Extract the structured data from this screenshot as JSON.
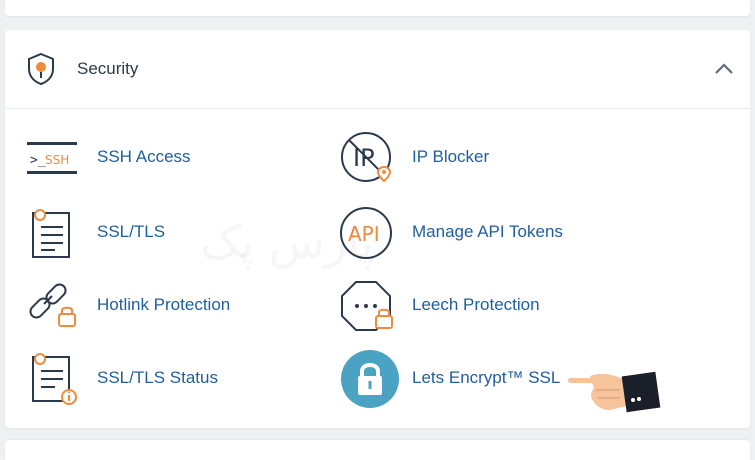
{
  "section": {
    "title": "Security",
    "icon": "security-shield-icon",
    "collapse_icon": "chevron-up-icon"
  },
  "items": [
    {
      "label": "SSH Access",
      "icon": "ssh-terminal-icon"
    },
    {
      "label": "IP Blocker",
      "icon": "ip-blocker-icon"
    },
    {
      "label": "SSL/TLS",
      "icon": "certificate-icon"
    },
    {
      "label": "Manage API Tokens",
      "icon": "api-icon"
    },
    {
      "label": "Hotlink Protection",
      "icon": "hotlink-chain-lock-icon"
    },
    {
      "label": "Leech Protection",
      "icon": "leech-protection-icon"
    },
    {
      "label": "SSL/TLS Status",
      "icon": "certificate-status-icon"
    },
    {
      "label": "Lets Encrypt™ SSL",
      "icon": "padlock-icon"
    }
  ],
  "watermark_text": "پارس پک",
  "colors": {
    "accent": "#f08a3c",
    "link": "#1f5e9e",
    "lets_encrypt_bg": "#4ba3c3"
  }
}
